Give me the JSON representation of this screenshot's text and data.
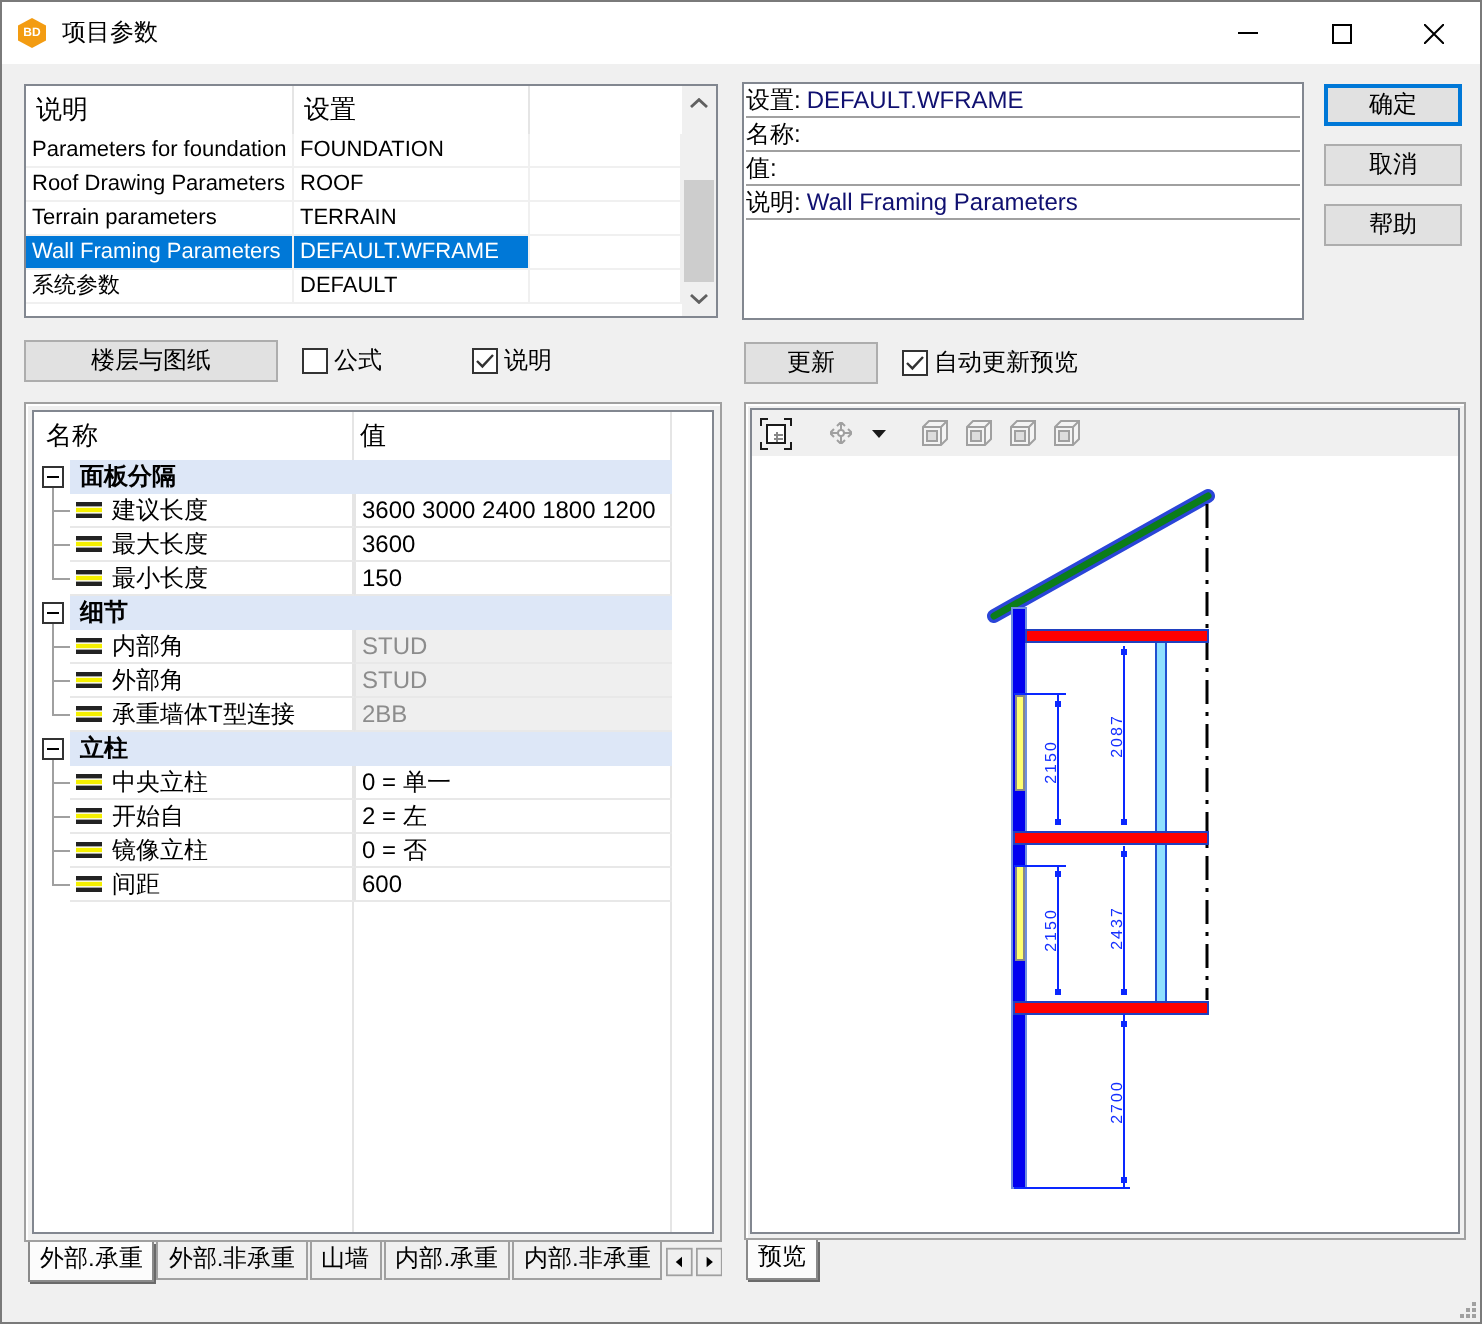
{
  "window": {
    "icon_text": "BD",
    "title": "项目参数"
  },
  "parameter_list": {
    "columns": [
      "说明",
      "设置"
    ],
    "rows": [
      {
        "description": "Parameters for foundation",
        "setting": "FOUNDATION",
        "selected": false
      },
      {
        "description": "Roof Drawing Parameters",
        "setting": "ROOF",
        "selected": false
      },
      {
        "description": "Terrain parameters",
        "setting": "TERRAIN",
        "selected": false
      },
      {
        "description": "Wall Framing Parameters",
        "setting": "DEFAULT.WFRAME",
        "selected": true
      },
      {
        "description": "系统参数",
        "setting": "DEFAULT",
        "selected": false
      }
    ]
  },
  "list_controls": {
    "button": "楼层与图纸",
    "checkboxes": [
      {
        "label": "公式",
        "checked": false
      },
      {
        "label": "说明",
        "checked": true
      }
    ]
  },
  "details": [
    {
      "label": "设置:",
      "value": "DEFAULT.WFRAME"
    },
    {
      "label": "名称:"
    },
    {
      "label": "值:"
    },
    {
      "label": "说明:",
      "value": "Wall Framing Parameters"
    }
  ],
  "dialog_buttons": [
    {
      "label": "确定",
      "default": true
    },
    {
      "label": "取消",
      "default": false
    },
    {
      "label": "帮助",
      "default": false
    }
  ],
  "preview_controls": {
    "button": "更新",
    "checkbox": {
      "label": "自动更新预览",
      "checked": true
    }
  },
  "property_grid": {
    "columns": [
      "名称",
      "值"
    ],
    "groups": [
      {
        "label": "面板分隔",
        "expanded": true,
        "rows": [
          {
            "name": "建议长度",
            "value": "3600 3000 2400 1800 1200",
            "disabled": false
          },
          {
            "name": "最大长度",
            "value": "3600",
            "disabled": false
          },
          {
            "name": "最小长度",
            "value": "150",
            "disabled": false
          }
        ]
      },
      {
        "label": "细节",
        "expanded": true,
        "rows": [
          {
            "name": "内部角",
            "value": "STUD",
            "disabled": true
          },
          {
            "name": "外部角",
            "value": "STUD",
            "disabled": true
          },
          {
            "name": "承重墙体T型连接",
            "value": "2BB",
            "disabled": true
          }
        ]
      },
      {
        "label": "立柱",
        "expanded": true,
        "rows": [
          {
            "name": "中央立柱",
            "value": "0 = 单一",
            "disabled": false
          },
          {
            "name": "开始自",
            "value": "2 = 左",
            "disabled": false
          },
          {
            "name": "镜像立柱",
            "value": "0 = 否",
            "disabled": false
          },
          {
            "name": "间距",
            "value": "600",
            "disabled": false
          }
        ]
      }
    ]
  },
  "wall_tabs": [
    {
      "label": "外部.承重",
      "selected": true
    },
    {
      "label": "外部.非承重",
      "selected": false
    },
    {
      "label": "山墙",
      "selected": false
    },
    {
      "label": "内部.承重",
      "selected": false
    },
    {
      "label": "内部.非承重",
      "selected": false
    }
  ],
  "preview": {
    "toolbar": [
      {
        "kind": "frame",
        "disabled": false
      },
      {
        "kind": "move",
        "disabled": true
      },
      {
        "kind": "dropdown",
        "disabled": false
      },
      {
        "kind": "view",
        "disabled": true
      },
      {
        "kind": "view",
        "disabled": true
      },
      {
        "kind": "view",
        "disabled": true
      },
      {
        "kind": "view",
        "disabled": true
      }
    ],
    "dimension_labels": [
      "2150",
      "2087",
      "2150",
      "2437",
      "2700"
    ],
    "tabs": [
      {
        "label": "预览",
        "selected": true
      }
    ]
  }
}
